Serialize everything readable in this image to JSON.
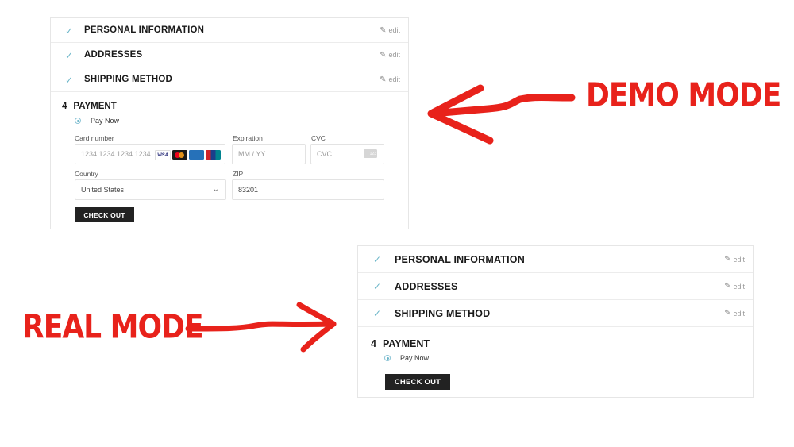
{
  "demo": {
    "label": "DEMO MODE",
    "steps": [
      {
        "title": "PERSONAL INFORMATION",
        "edit": "edit"
      },
      {
        "title": "ADDRESSES",
        "edit": "edit"
      },
      {
        "title": "SHIPPING METHOD",
        "edit": "edit"
      }
    ],
    "payment": {
      "number": "4",
      "title": "PAYMENT",
      "option": "Pay Now",
      "card_number_label": "Card number",
      "card_number_placeholder": "1234 1234 1234 1234",
      "expiration_label": "Expiration",
      "expiration_placeholder": "MM / YY",
      "cvc_label": "CVC",
      "cvc_placeholder": "CVC",
      "country_label": "Country",
      "country_value": "United States",
      "zip_label": "ZIP",
      "zip_value": "83201",
      "card_brands": [
        "VISA",
        "mastercard",
        "amex",
        "unionpay"
      ],
      "checkout": "CHECK OUT"
    }
  },
  "real": {
    "label": "REAL MODE",
    "steps": [
      {
        "title": "PERSONAL INFORMATION",
        "edit": "edit"
      },
      {
        "title": "ADDRESSES",
        "edit": "edit"
      },
      {
        "title": "SHIPPING METHOD",
        "edit": "edit"
      }
    ],
    "payment": {
      "number": "4",
      "title": "PAYMENT",
      "option": "Pay Now",
      "checkout": "CHECK OUT"
    }
  },
  "colors": {
    "accent": "#6bb6c9",
    "annotation": "#e8221b",
    "button": "#222222"
  },
  "icons": [
    "check-icon",
    "pencil-icon",
    "chevron-down-icon",
    "cvc-card-icon"
  ]
}
